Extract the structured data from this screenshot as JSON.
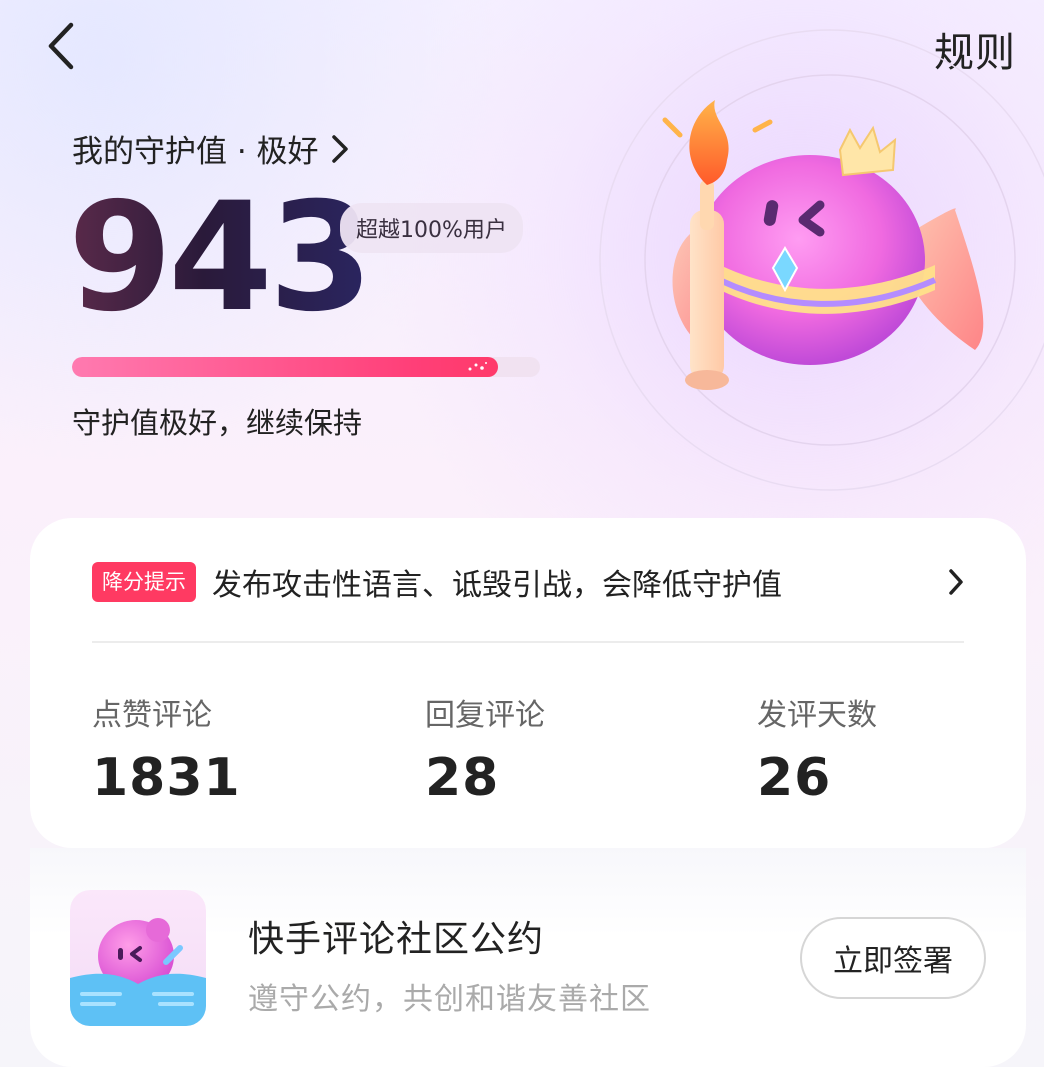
{
  "header": {
    "back_icon": "chevron-left-icon",
    "rules_label": "规则"
  },
  "hero": {
    "level_label": "我的守护值 · 极好",
    "score": "943",
    "rank_text": "超越100%用户",
    "progress_fraction": 0.91,
    "status_text": "守护值极好，继续保持"
  },
  "notice": {
    "badge": "降分提示",
    "text": "发布攻击性语言、诋毁引战，会降低守护值"
  },
  "stats": [
    {
      "label": "点赞评论",
      "value": "1831"
    },
    {
      "label": "回复评论",
      "value": "28"
    },
    {
      "label": "发评天数",
      "value": "26"
    }
  ],
  "convention": {
    "title": "快手评论社区公约",
    "subtitle": "遵守公约，共创和谐友善社区",
    "button_label": "立即签署"
  },
  "colors": {
    "accent_pink": "#ff3a62",
    "progress_start": "#ff7ab0",
    "progress_end": "#ff3a6a"
  }
}
